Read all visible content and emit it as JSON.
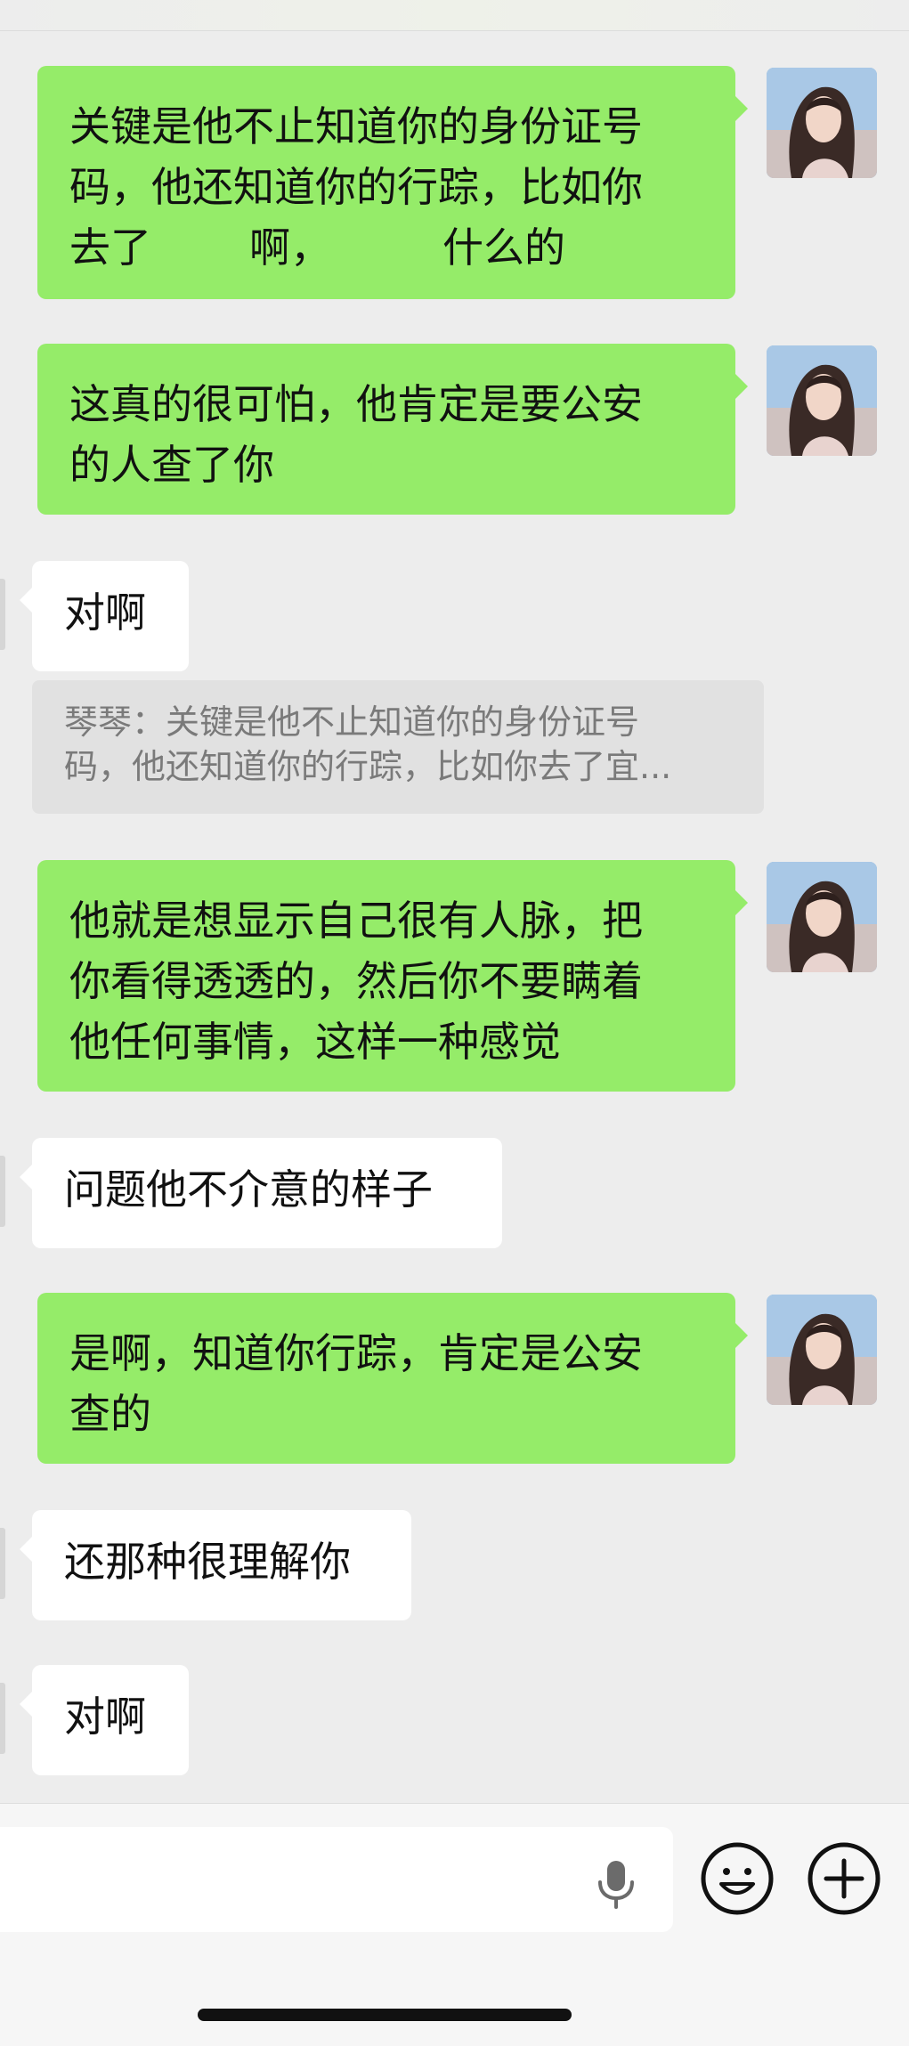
{
  "messages": [
    {
      "side": "me",
      "parts": [
        "关键是他不止知道你的身份证号",
        "码，他还知道你的行踪，比如你",
        "去了",
        "啊，",
        "什么的"
      ]
    },
    {
      "side": "me",
      "lines": [
        "这真的很可怕，他肯定是要公安",
        "的人查了你"
      ]
    },
    {
      "side": "them",
      "text": "对啊"
    },
    {
      "quote": [
        "琴琴：关键是他不止知道你的身份证号",
        "码，他还知道你的行踪，比如你去了宜..."
      ]
    },
    {
      "side": "me",
      "lines": [
        "他就是想显示自己很有人脉，把",
        "你看得透透的，然后你不要瞒着",
        "他任何事情，这样一种感觉"
      ]
    },
    {
      "side": "them",
      "text": "问题他不介意的样子"
    },
    {
      "side": "me",
      "lines": [
        "是啊，知道你行踪，肯定是公安",
        "查的"
      ]
    },
    {
      "side": "them",
      "text": "还那种很理解你"
    },
    {
      "side": "them",
      "text": "对啊"
    }
  ],
  "input_bar": {
    "icons": [
      "microphone-icon",
      "emoji-icon",
      "plus-icon"
    ]
  },
  "colors": {
    "background": "#ededed",
    "my_bubble": "#95ec69",
    "their_bubble": "#ffffff",
    "quote_bg": "#e1e1e1"
  }
}
